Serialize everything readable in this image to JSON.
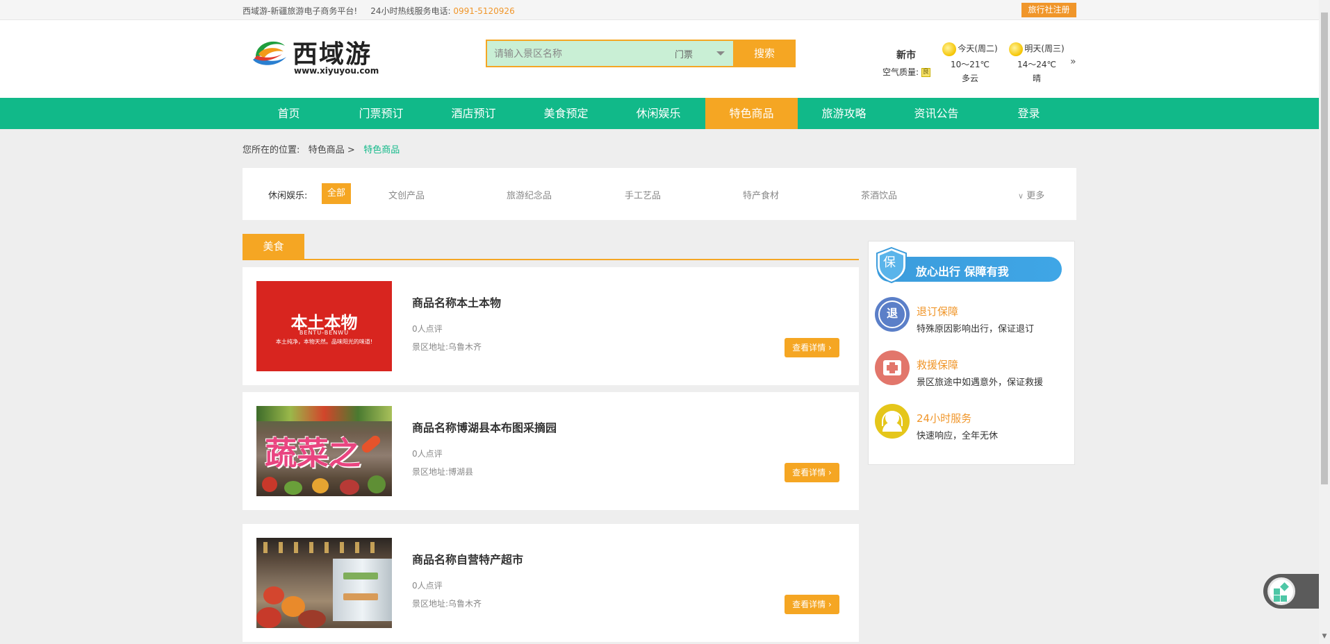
{
  "topbar": {
    "site_info": "西域游-新疆旅游电子商务平台!",
    "hotline_label": "24小时热线服务电话:",
    "hotline_number": "0991-5120926",
    "agency_register": "旅行社注册"
  },
  "header": {
    "logo_text": "西域游",
    "logo_url": "www.xiyuyou.com",
    "search_placeholder": "请输入景区名称",
    "search_category": "门票",
    "search_button": "搜索",
    "city": "新市",
    "air_quality_label": "空气质量:",
    "air_quality_value": "良",
    "weather": [
      {
        "day": "今天(周二)",
        "temp": "10～21℃",
        "desc": "多云"
      },
      {
        "day": "明天(周三)",
        "temp": "14～24℃",
        "desc": "晴"
      }
    ],
    "weather_more": "»"
  },
  "nav": {
    "items": [
      "首页",
      "门票预订",
      "酒店预订",
      "美食预定",
      "休闲娱乐",
      "特色商品",
      "旅游攻略",
      "资讯公告",
      "登录"
    ],
    "active_index": 5
  },
  "breadcrumb": {
    "label": "您所在的位置:",
    "parent": "特色商品 >",
    "current": "特色商品"
  },
  "filter": {
    "label": "休闲娱乐:",
    "all": "全部",
    "options": [
      "文创产品",
      "旅游纪念品",
      "手工艺品",
      "特产食材",
      "茶酒饮品"
    ],
    "more": "更多"
  },
  "section_tab": "美食",
  "products": [
    {
      "name": "商品名称本土本物",
      "reviews": "0人点评",
      "address": "景区地址:乌鲁木齐",
      "detail": "查看详情",
      "img_title": "本土本物",
      "img_sub": "BENTU-BENWU",
      "img_slogan": "本土纯净，本物天然。品味阳光的味道!"
    },
    {
      "name": "商品名称博湖县本布图采摘园",
      "reviews": "0人点评",
      "address": "景区地址:博湖县",
      "detail": "查看详情",
      "img_title": "蔬菜之",
      "img_sub": "",
      "img_slogan": ""
    },
    {
      "name": "商品名称自营特产超市",
      "reviews": "0人点评",
      "address": "景区地址:乌鲁木齐",
      "detail": "查看详情",
      "img_title": "",
      "img_sub": "",
      "img_slogan": ""
    }
  ],
  "guarantee": {
    "banner_icon": "保",
    "banner": "放心出行  保障有我",
    "items": [
      {
        "icon": "退",
        "title": "退订保障",
        "desc": "特殊原因影响出行，保证退订",
        "color": "#5b7fc8"
      },
      {
        "icon": "+",
        "title": "救援保障",
        "desc": "景区旅途中如遇意外，保证救援",
        "color": "#e2766b"
      },
      {
        "icon": "headset",
        "title": "24小时服务",
        "desc": "快速响应，全年无休",
        "color": "#e5c61a"
      }
    ]
  },
  "colors": {
    "accent": "#f5a623",
    "nav": "#11b989",
    "link_orange": "#f0962a"
  }
}
